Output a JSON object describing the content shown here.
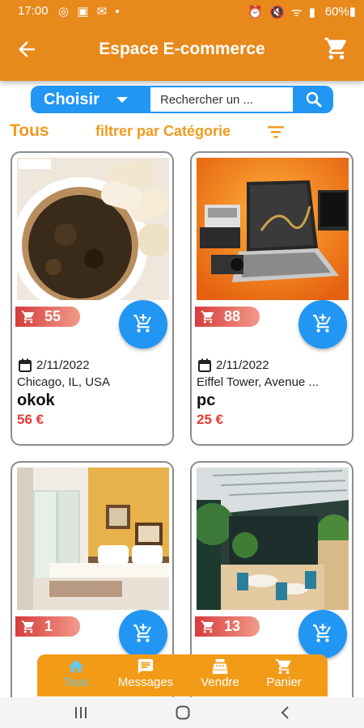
{
  "status_bar": {
    "time": "17:00",
    "icons_left": "◎ ▣ ✉ •",
    "icons_right": "⏰ 🔇 ᯤ ▮",
    "battery": "60%▮"
  },
  "header": {
    "title": "Espace E-commerce",
    "back_icon": "arrow-left-icon",
    "cart_icon": "cart-icon"
  },
  "search": {
    "category_button": "Choisir",
    "placeholder": "Rechercher un ...",
    "search_icon": "search-icon"
  },
  "filters": {
    "all_label": "Tous",
    "filter_label": "filtrer par Catégorie"
  },
  "products": [
    {
      "count": "55",
      "date": "2/11/2022",
      "location": "Chicago, IL, USA",
      "name": "okok",
      "price": "56 €"
    },
    {
      "count": "88",
      "date": "2/11/2022",
      "location": "Eiffel Tower, Avenue ...",
      "name": "pc",
      "price": "25 €"
    },
    {
      "count": "1"
    },
    {
      "count": "13"
    }
  ],
  "bottom_nav": [
    {
      "label": "Tous",
      "icon": "home-icon",
      "active": true
    },
    {
      "label": "Messages",
      "icon": "message-icon"
    },
    {
      "label": "Vendre",
      "icon": "cash-register-icon"
    },
    {
      "label": "Panier",
      "icon": "cart-icon"
    }
  ],
  "colors": {
    "primary": "#e8891c",
    "accent": "#2196f3",
    "price": "#e53935",
    "nav": "#f29b17",
    "nav_active": "#64c8f0"
  }
}
